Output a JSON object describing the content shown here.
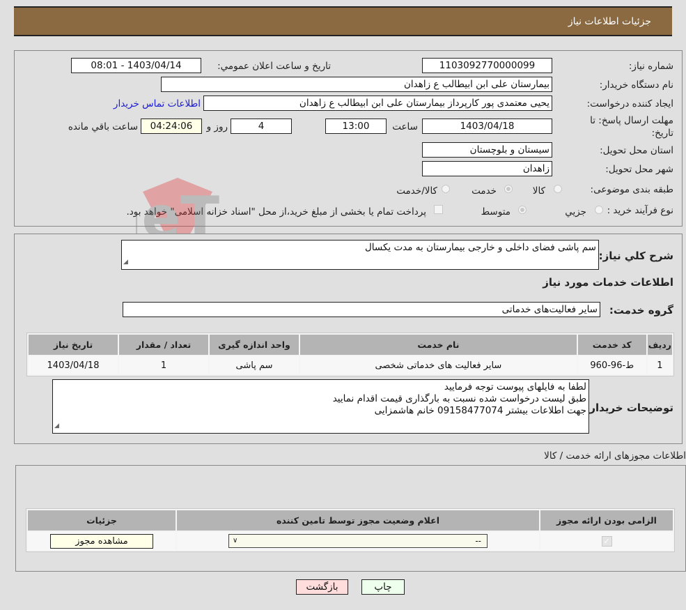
{
  "header": {
    "title": "جزئیات اطلاعات نیاز"
  },
  "info": {
    "need_number_label": "شماره نیاز:",
    "need_number": "1103092770000099",
    "announce_label": "تاریخ و ساعت اعلان عمومي:",
    "announce_value": "1403/04/14 - 08:01",
    "buyer_org_label": "نام دستگاه خریدار:",
    "buyer_org": "بیمارستان علی ابن ابیطالب  ع  زاهدان",
    "creator_label": "ایجاد کننده درخواست:",
    "creator": "یحیی معتمدی پور کارپرداز بیمارستان علی ابن ابیطالب  ع  زاهدان",
    "contact_link": "اطلاعات تماس خریدار",
    "deadline_label_1": "مهلت ارسال پاسخ: تا",
    "deadline_label_2": "تاریخ:",
    "deadline_date": "1403/04/18",
    "time_label": "ساعت",
    "deadline_time": "13:00",
    "days_value": "4",
    "days_label": "روز و",
    "remaining_time": "04:24:06",
    "remaining_label": "ساعت باقي مانده",
    "province_label": "استان محل تحویل:",
    "province": "سیستان و بلوچستان",
    "city_label": "شهر محل تحویل:",
    "city": "زاهدان",
    "category_label": "طبقه بندی موضوعی:",
    "category_options": [
      {
        "label": "کالا",
        "selected": false
      },
      {
        "label": "خدمت",
        "selected": true
      },
      {
        "label": "کالا/خدمت",
        "selected": false
      }
    ],
    "purchase_type_label": "نوع فرآیند خرید :",
    "purchase_options": [
      {
        "label": "جزيي",
        "selected": false
      },
      {
        "label": "متوسط",
        "selected": true
      }
    ],
    "treasury_note": "پرداخت تمام یا بخشی از مبلغ خرید،از محل \"اسناد خزانه اسلامی\" خواهد بود."
  },
  "services": {
    "summary_label": "شرح کلي نیاز:",
    "summary": "سم پاشی فضای داخلی و خارجی بیمارستان به مدت یکسال",
    "section_title": "اطلاعات خدمات مورد نیاز",
    "group_label": "گروه خدمت:",
    "group_value": "سایر فعالیت‌های خدماتی",
    "table": {
      "headers": [
        "ردیف",
        "کد خدمت",
        "نام خدمت",
        "واحد اندازه گیری",
        "تعداد / مقدار",
        "تاریخ نیاز"
      ],
      "rows": [
        [
          "1",
          "ط-96-960",
          "سایر فعالیت های خدماتی شخصی",
          "سم پاشی",
          "1",
          "1403/04/18"
        ]
      ]
    },
    "buyer_notes_label": "توضیحات خریدار:",
    "buyer_notes": [
      "لطفا به فایلهای پیوست توجه فرمایید",
      "طبق لیست درخواست شده نسبت به بارگذاری قیمت اقدام نمایید",
      "جهت اطلاعات بیشتر 09158477074 خانم هاشمزایی"
    ]
  },
  "licenses": {
    "title": "اطلاعات مجوزهای ارائه خدمت / کالا",
    "headers": [
      "الزامی بودن ارائه مجوز",
      "اعلام وضعیت مجوز توسط تامین کننده",
      "جزئیات"
    ],
    "row": {
      "required": true,
      "status_value": "--",
      "details_button": "مشاهده مجوز"
    }
  },
  "footer": {
    "print_button": "چاپ",
    "back_button": "بازگشت"
  },
  "watermark": "AriaTender.neT"
}
